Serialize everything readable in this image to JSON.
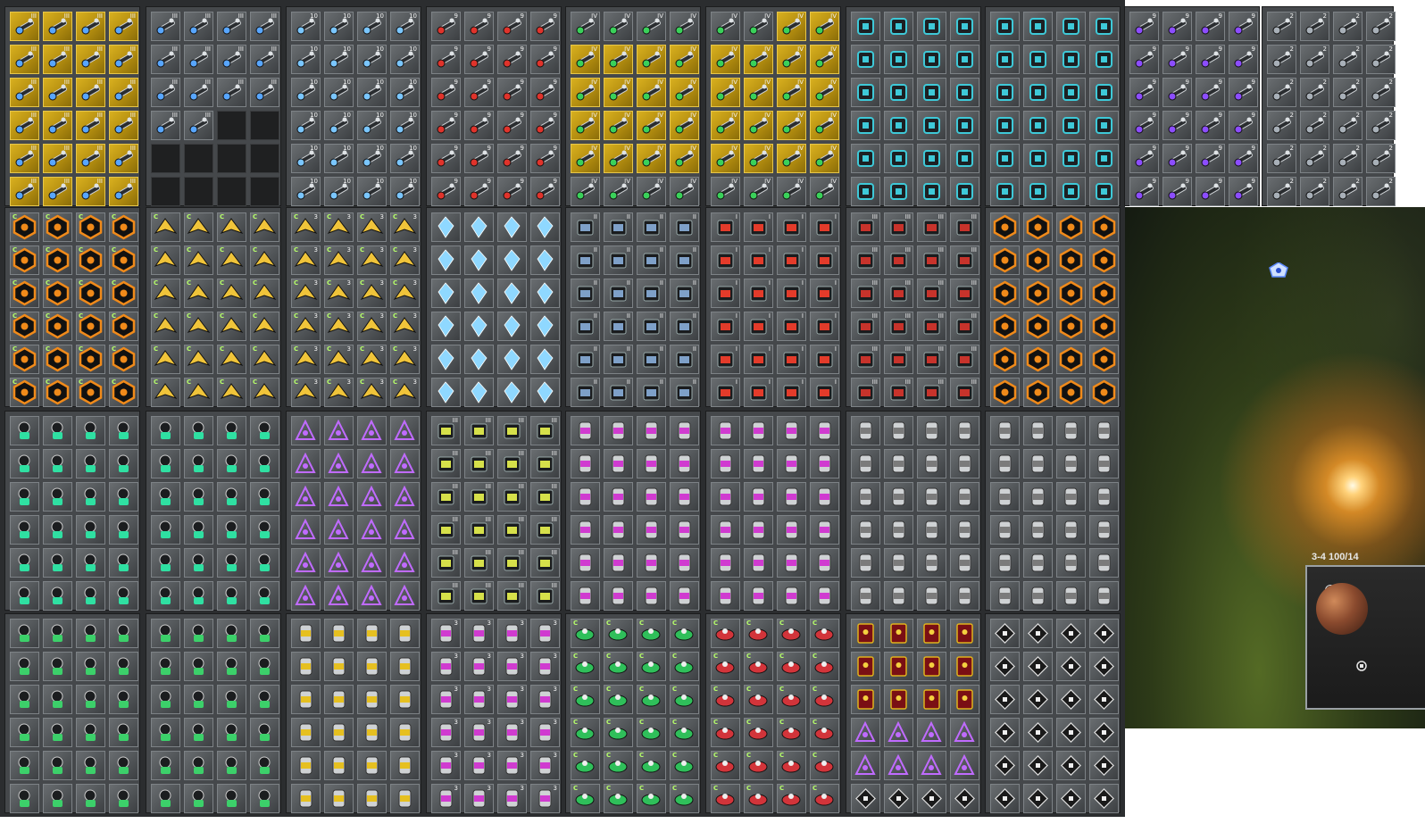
{
  "window": {
    "title": ""
  },
  "hud": {
    "sector_label": "3-4 100/14"
  },
  "colors": {
    "panel_bg": "#45484b",
    "slot_gold": "#c9a116",
    "space_star": "#ffd27a",
    "tier_text": "#f2f2f2",
    "badge_green": "#b6ff6a"
  },
  "stash_panels": [
    {
      "row": 0,
      "col": 0,
      "style": "gold",
      "icon": "weapon-cannon-icon",
      "tier": "III",
      "badge": ""
    },
    {
      "row": 0,
      "col": 1,
      "style": "gray",
      "icon": "weapon-cannon-icon",
      "tier": "III",
      "badge": ""
    },
    {
      "row": 0,
      "col": 2,
      "style": "gray",
      "icon": "weapon-laser-icon",
      "tier": "10",
      "badge": ""
    },
    {
      "row": 0,
      "col": 3,
      "style": "gray",
      "icon": "weapon-red-gun-icon",
      "tier": "9",
      "badge": ""
    },
    {
      "row": 0,
      "col": 4,
      "style": "mixed-gold",
      "icon": "weapon-green-gun-icon",
      "tier": "IV",
      "badge": ""
    },
    {
      "row": 0,
      "col": 5,
      "style": "mixed-gold",
      "icon": "weapon-green-gun-icon",
      "tier": "IV",
      "badge": ""
    },
    {
      "row": 0,
      "col": 6,
      "style": "gray",
      "icon": "module-device-icon",
      "tier": "",
      "badge": ""
    },
    {
      "row": 0,
      "col": 7,
      "style": "gray",
      "icon": "module-device-icon",
      "tier": "",
      "badge": ""
    },
    {
      "row": 0,
      "col": 8,
      "style": "gray",
      "icon": "weapon-purple-gun-icon",
      "tier": "9",
      "badge": ""
    },
    {
      "row": 0,
      "col": 9,
      "style": "gray",
      "icon": "weapon-silver-gun-icon",
      "tier": "2",
      "badge": ""
    },
    {
      "row": 1,
      "col": 0,
      "style": "gray",
      "icon": "emblem-orange-icon",
      "tier": "",
      "badge": "C"
    },
    {
      "row": 1,
      "col": 1,
      "style": "gray",
      "icon": "ship-fighter-icon",
      "tier": "",
      "badge": "C"
    },
    {
      "row": 1,
      "col": 2,
      "style": "gray",
      "icon": "ship-fighter-icon",
      "tier": "3",
      "badge": "C"
    },
    {
      "row": 1,
      "col": 3,
      "style": "gray",
      "icon": "crystal-resource-icon",
      "tier": "",
      "badge": ""
    },
    {
      "row": 1,
      "col": 4,
      "style": "gray",
      "icon": "turret-robot-icon",
      "tier": "II",
      "badge": ""
    },
    {
      "row": 1,
      "col": 5,
      "style": "gray",
      "icon": "turret-red-icon",
      "tier": "I",
      "badge": ""
    },
    {
      "row": 1,
      "col": 6,
      "style": "gray",
      "icon": "turret-black-icon",
      "tier": "III",
      "badge": ""
    },
    {
      "row": 1,
      "col": 7,
      "style": "gray",
      "icon": "emblem-orange-icon",
      "tier": "",
      "badge": ""
    },
    {
      "row": 2,
      "col": 0,
      "style": "gray",
      "icon": "droid-green-icon",
      "tier": "",
      "badge": ""
    },
    {
      "row": 2,
      "col": 1,
      "style": "gray",
      "icon": "droid-green-icon",
      "tier": "",
      "badge": ""
    },
    {
      "row": 2,
      "col": 2,
      "style": "gray",
      "icon": "item-mixed-icon",
      "tier": "",
      "badge": ""
    },
    {
      "row": 2,
      "col": 3,
      "style": "gray",
      "icon": "turret-yellow-icon",
      "tier": "III",
      "badge": ""
    },
    {
      "row": 2,
      "col": 4,
      "style": "gray",
      "icon": "canister-pink-icon",
      "tier": "",
      "badge": ""
    },
    {
      "row": 2,
      "col": 5,
      "style": "gray",
      "icon": "canister-pink-icon",
      "tier": "",
      "badge": ""
    },
    {
      "row": 2,
      "col": 6,
      "style": "gray",
      "icon": "canister-skull-icon",
      "tier": "",
      "badge": ""
    },
    {
      "row": 2,
      "col": 7,
      "style": "gray",
      "icon": "canister-skull-icon",
      "tier": "",
      "badge": ""
    },
    {
      "row": 3,
      "col": 0,
      "style": "gray",
      "icon": "helmet-green-icon",
      "tier": "",
      "badge": ""
    },
    {
      "row": 3,
      "col": 1,
      "style": "gray",
      "icon": "helmet-green-icon",
      "tier": "",
      "badge": ""
    },
    {
      "row": 3,
      "col": 2,
      "style": "gray",
      "icon": "barrel-blue-yellow-icon",
      "tier": "",
      "badge": ""
    },
    {
      "row": 3,
      "col": 3,
      "style": "gray",
      "icon": "canister-pink-icon",
      "tier": "3",
      "badge": ""
    },
    {
      "row": 3,
      "col": 4,
      "style": "gray",
      "icon": "drone-green-icon",
      "tier": "",
      "badge": "C"
    },
    {
      "row": 3,
      "col": 5,
      "style": "gray",
      "icon": "drone-red-icon",
      "tier": "",
      "badge": "C"
    },
    {
      "row": 3,
      "col": 6,
      "style": "mixed-red",
      "icon": "card-red-icon",
      "tier": "",
      "badge": ""
    },
    {
      "row": 3,
      "col": 7,
      "style": "gray",
      "icon": "chip-dark-icon",
      "tier": "",
      "badge": ""
    }
  ]
}
